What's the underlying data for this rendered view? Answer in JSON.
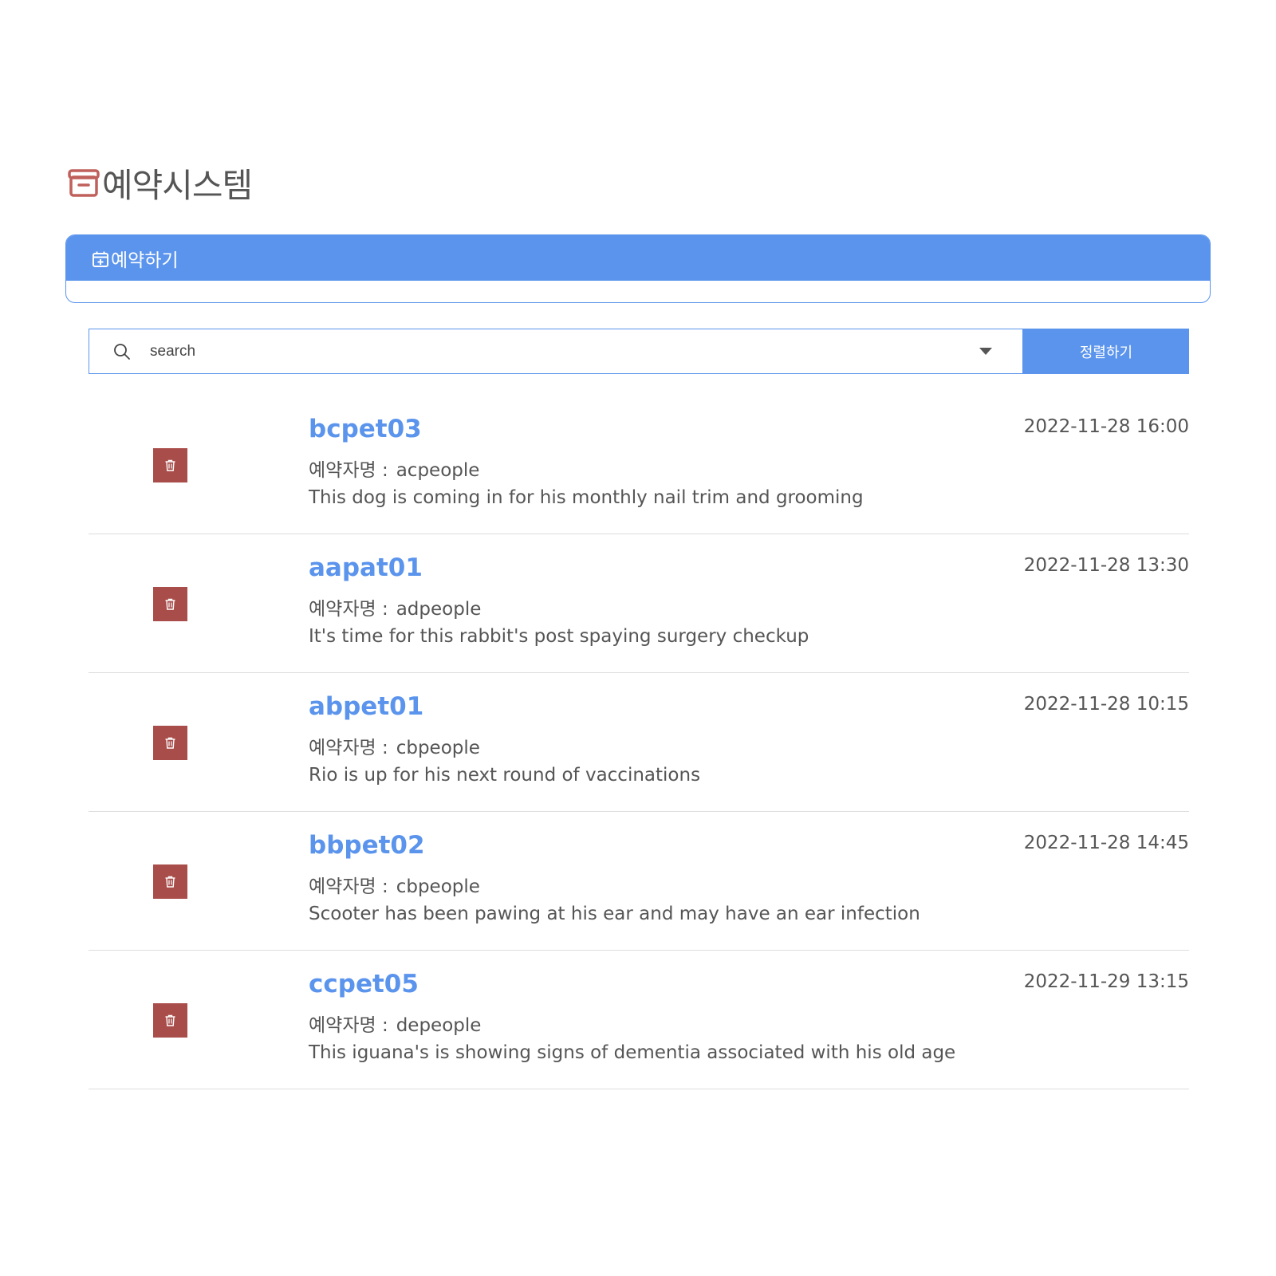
{
  "header": {
    "title": "예약시스템",
    "title_icon": "archive-box-icon",
    "title_icon_color": "#c0605c"
  },
  "reserve_panel": {
    "label": "예약하기",
    "icon": "calendar-plus-icon"
  },
  "search": {
    "placeholder": "search",
    "sort_label": "정렬하기"
  },
  "colors": {
    "accent": "#5b94ec",
    "delete": "#a94d4a",
    "text": "#555555"
  },
  "reservations": [
    {
      "pet_id": "bcpet03",
      "owner_label": "예약자명 :",
      "owner": "acpeople",
      "description": "This dog is coming in for his monthly nail trim and grooming",
      "datetime": "2022-11-28 16:00"
    },
    {
      "pet_id": "aapat01",
      "owner_label": "예약자명 :",
      "owner": "adpeople",
      "description": "It's time for this rabbit's post spaying surgery checkup",
      "datetime": "2022-11-28 13:30"
    },
    {
      "pet_id": "abpet01",
      "owner_label": "예약자명 :",
      "owner": "cbpeople",
      "description": "Rio is up for his next round of vaccinations",
      "datetime": "2022-11-28 10:15"
    },
    {
      "pet_id": "bbpet02",
      "owner_label": "예약자명 :",
      "owner": "cbpeople",
      "description": "Scooter has been pawing at his ear and may have an ear infection",
      "datetime": "2022-11-28 14:45"
    },
    {
      "pet_id": "ccpet05",
      "owner_label": "예약자명 :",
      "owner": "depeople",
      "description": "This iguana's is showing signs of dementia associated with his old age",
      "datetime": "2022-11-29 13:15"
    }
  ]
}
